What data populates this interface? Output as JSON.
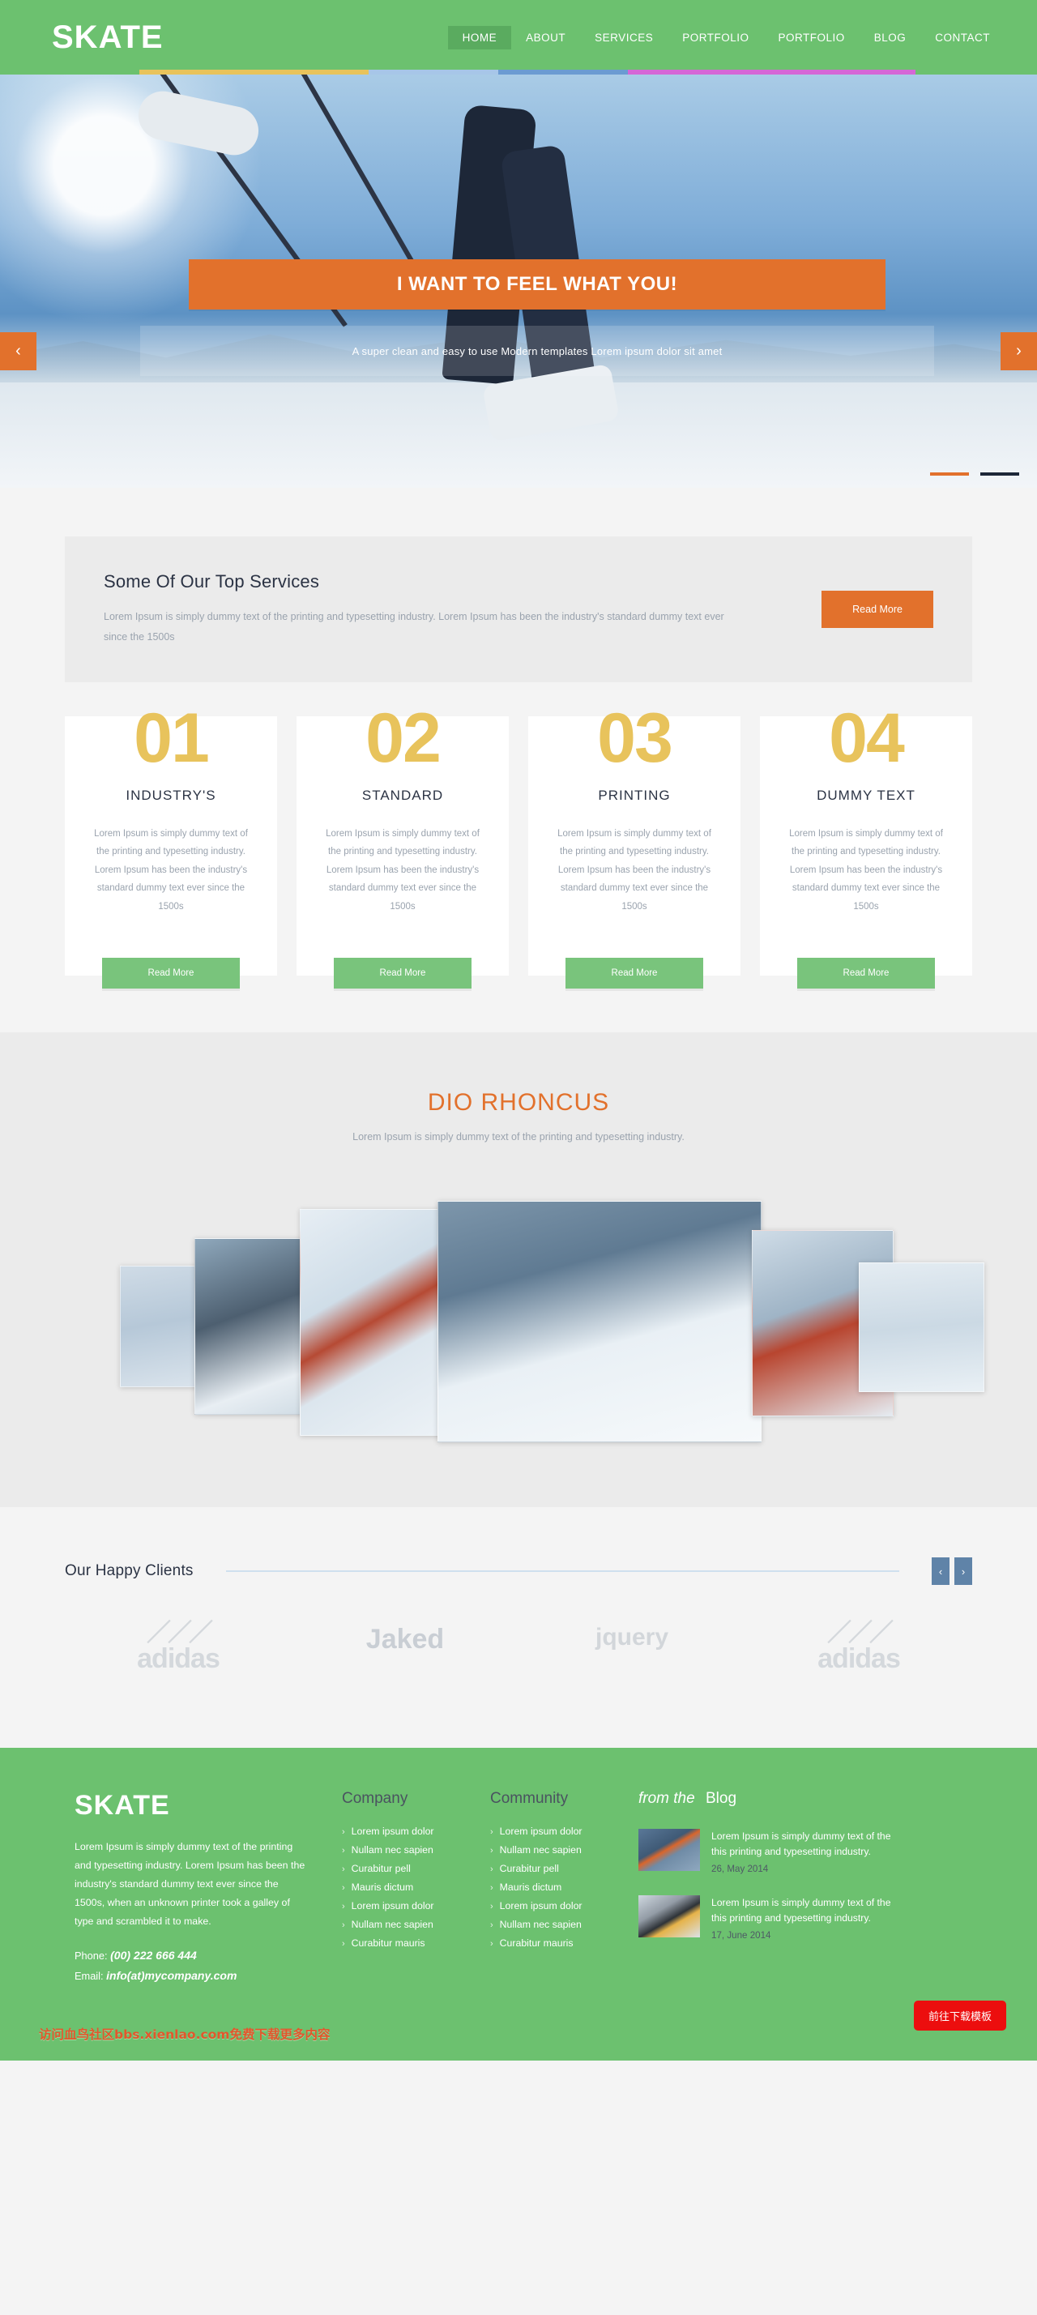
{
  "header": {
    "logo": "SKATE",
    "nav": [
      {
        "label": "HOME",
        "active": true
      },
      {
        "label": "ABOUT",
        "active": false
      },
      {
        "label": "SERVICES",
        "active": false
      },
      {
        "label": "PORTFOLIO",
        "active": false
      },
      {
        "label": "PORTFOLIO",
        "active": false
      },
      {
        "label": "BLOG",
        "active": false
      },
      {
        "label": "CONTACT",
        "active": false
      }
    ],
    "accent_colors": [
      "#e8c35c",
      "#a7c6e8",
      "#6b9bd2",
      "#d567d6"
    ],
    "brand_green": "#6cc16f"
  },
  "hero": {
    "banner_title": "I WANT TO FEEL WHAT YOU!",
    "subtitle": "A super clean and easy to use Modern templates Lorem ipsum dolor sit amet",
    "prev_icon": "chevron-left-icon",
    "next_icon": "chevron-right-icon",
    "prev_glyph": "‹",
    "next_glyph": "›",
    "slides_total": 2,
    "slide_active": 1,
    "accent": "#e2712c"
  },
  "top_services": {
    "title": "Some Of Our Top Services",
    "text": "Lorem Ipsum is simply dummy text of the printing and typesetting industry. Lorem Ipsum has been the industry's standard dummy text ever since the 1500s",
    "button": "Read More"
  },
  "cards": [
    {
      "number": "01",
      "title": "INDUSTRY'S",
      "text": "Lorem Ipsum is simply dummy text of the printing and typesetting industry. Lorem Ipsum has been the industry's standard dummy text ever since the 1500s",
      "button": "Read More"
    },
    {
      "number": "02",
      "title": "STANDARD",
      "text": "Lorem Ipsum is simply dummy text of the printing and typesetting industry. Lorem Ipsum has been the industry's standard dummy text ever since the 1500s",
      "button": "Read More"
    },
    {
      "number": "03",
      "title": "PRINTING",
      "text": "Lorem Ipsum is simply dummy text of the printing and typesetting industry. Lorem Ipsum has been the industry's standard dummy text ever since the 1500s",
      "button": "Read More"
    },
    {
      "number": "04",
      "title": "DUMMY TEXT",
      "text": "Lorem Ipsum is simply dummy text of the printing and typesetting industry. Lorem Ipsum has been the industry's standard dummy text ever since the 1500s",
      "button": "Read More"
    }
  ],
  "rhoncus": {
    "title": "DIO RHONCUS",
    "subtitle": "Lorem Ipsum is simply dummy text of the printing and typesetting industry.",
    "gallery_count": 6
  },
  "clients": {
    "title": "Our Happy Clients",
    "prev_glyph": "‹",
    "next_glyph": "›",
    "logos": [
      {
        "name": "adidas",
        "type": "adidas"
      },
      {
        "name": "Jaked",
        "type": "jaked"
      },
      {
        "name": "jquery",
        "type": "jquery"
      },
      {
        "name": "adidas",
        "type": "adidas"
      }
    ]
  },
  "footer": {
    "logo": "SKATE",
    "about": "Lorem Ipsum is simply dummy text of the printing and typesetting industry. Lorem Ipsum has been the industry's standard dummy text ever since the 1500s, when an unknown printer took a galley of type and scrambled it to make.",
    "phone_label": "Phone:",
    "phone": "(00) 222 666 444",
    "email_label": "Email:",
    "email": "info(at)mycompany.com",
    "columns": [
      {
        "heading": "Company",
        "items": [
          "Lorem ipsum dolor",
          "Nullam nec sapien",
          "Curabitur pell",
          "Mauris dictum",
          "Lorem ipsum dolor",
          "Nullam nec sapien",
          "Curabitur mauris"
        ]
      },
      {
        "heading": "Community",
        "items": [
          "Lorem ipsum dolor",
          "Nullam nec sapien",
          "Curabitur pell",
          "Mauris dictum",
          "Lorem ipsum dolor",
          "Nullam nec sapien",
          "Curabitur mauris"
        ]
      }
    ],
    "blog": {
      "heading_italic": "from the",
      "heading_bold": "Blog",
      "posts": [
        {
          "text": "Lorem Ipsum is simply dummy text of the this printing and typesetting industry.",
          "date": "26, May 2014"
        },
        {
          "text": "Lorem Ipsum is simply dummy text of the this printing and typesetting industry.",
          "date": "17, June 2014"
        }
      ]
    }
  },
  "overlay": {
    "watermark": "访问血鸟社区bbs.xienlao.com免费下载更多内容",
    "download_button": "前往下载模板"
  }
}
